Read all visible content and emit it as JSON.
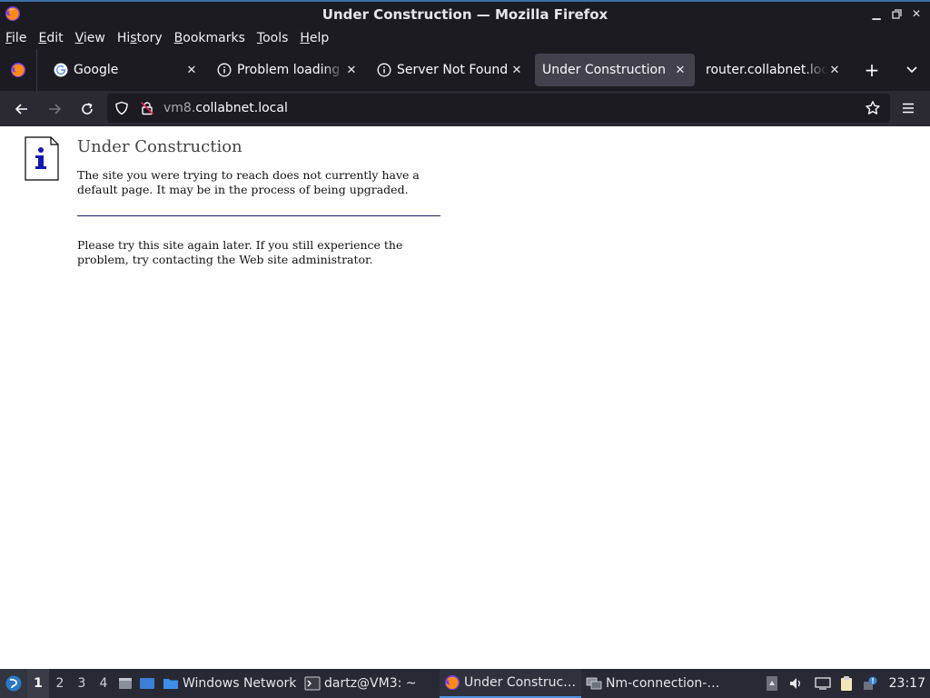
{
  "window": {
    "title": "Under Construction — Mozilla Firefox"
  },
  "menu": [
    {
      "label": "File",
      "key": "F",
      "rest": "ile"
    },
    {
      "label": "Edit",
      "key": "E",
      "rest": "dit"
    },
    {
      "label": "View",
      "key": "V",
      "rest": "iew"
    },
    {
      "label": "History",
      "key": "s",
      "pre": "Hi",
      "rest": "tory"
    },
    {
      "label": "Bookmarks",
      "key": "B",
      "rest": "ookmarks"
    },
    {
      "label": "Tools",
      "key": "T",
      "rest": "ools"
    },
    {
      "label": "Help",
      "key": "H",
      "rest": "elp"
    }
  ],
  "tabs": [
    {
      "label": "Google",
      "icon": "google-icon",
      "active": false
    },
    {
      "label": "Problem loading page",
      "icon": "info-icon",
      "active": false
    },
    {
      "label": "Server Not Found",
      "icon": "info-icon",
      "active": false
    },
    {
      "label": "Under Construction",
      "icon": "none",
      "active": true
    },
    {
      "label": "router.collabnet.local/",
      "icon": "none",
      "active": false
    }
  ],
  "urlbar": {
    "host_prefix": "vm8.",
    "host_domain": "collabnet.local"
  },
  "page": {
    "title": "Under Construction",
    "message1": "The site you were trying to reach does not currently have a default page. It may be in the process of being upgraded.",
    "message2": "Please try this site again later. If you still experience the problem, try contacting the Web site administrator."
  },
  "taskbar": {
    "workspaces": [
      "1",
      "2",
      "3",
      "4"
    ],
    "active_workspace": "1",
    "tasks": [
      {
        "label": "Windows Network",
        "icon": "folder-icon",
        "active": false
      },
      {
        "label": "dartz@VM3: ~",
        "icon": "terminal-icon",
        "active": false
      },
      {
        "label": "Under Construc…",
        "icon": "firefox-icon",
        "active": true
      },
      {
        "label": "Nm-connection-…",
        "icon": "network-icon",
        "active": false
      }
    ],
    "clock": "23:17"
  },
  "colors": {
    "accent": "#5294e2",
    "chrome_bg": "#1c1b22",
    "toolbar_bg": "#2b2a33",
    "active_tab": "#42414d"
  }
}
